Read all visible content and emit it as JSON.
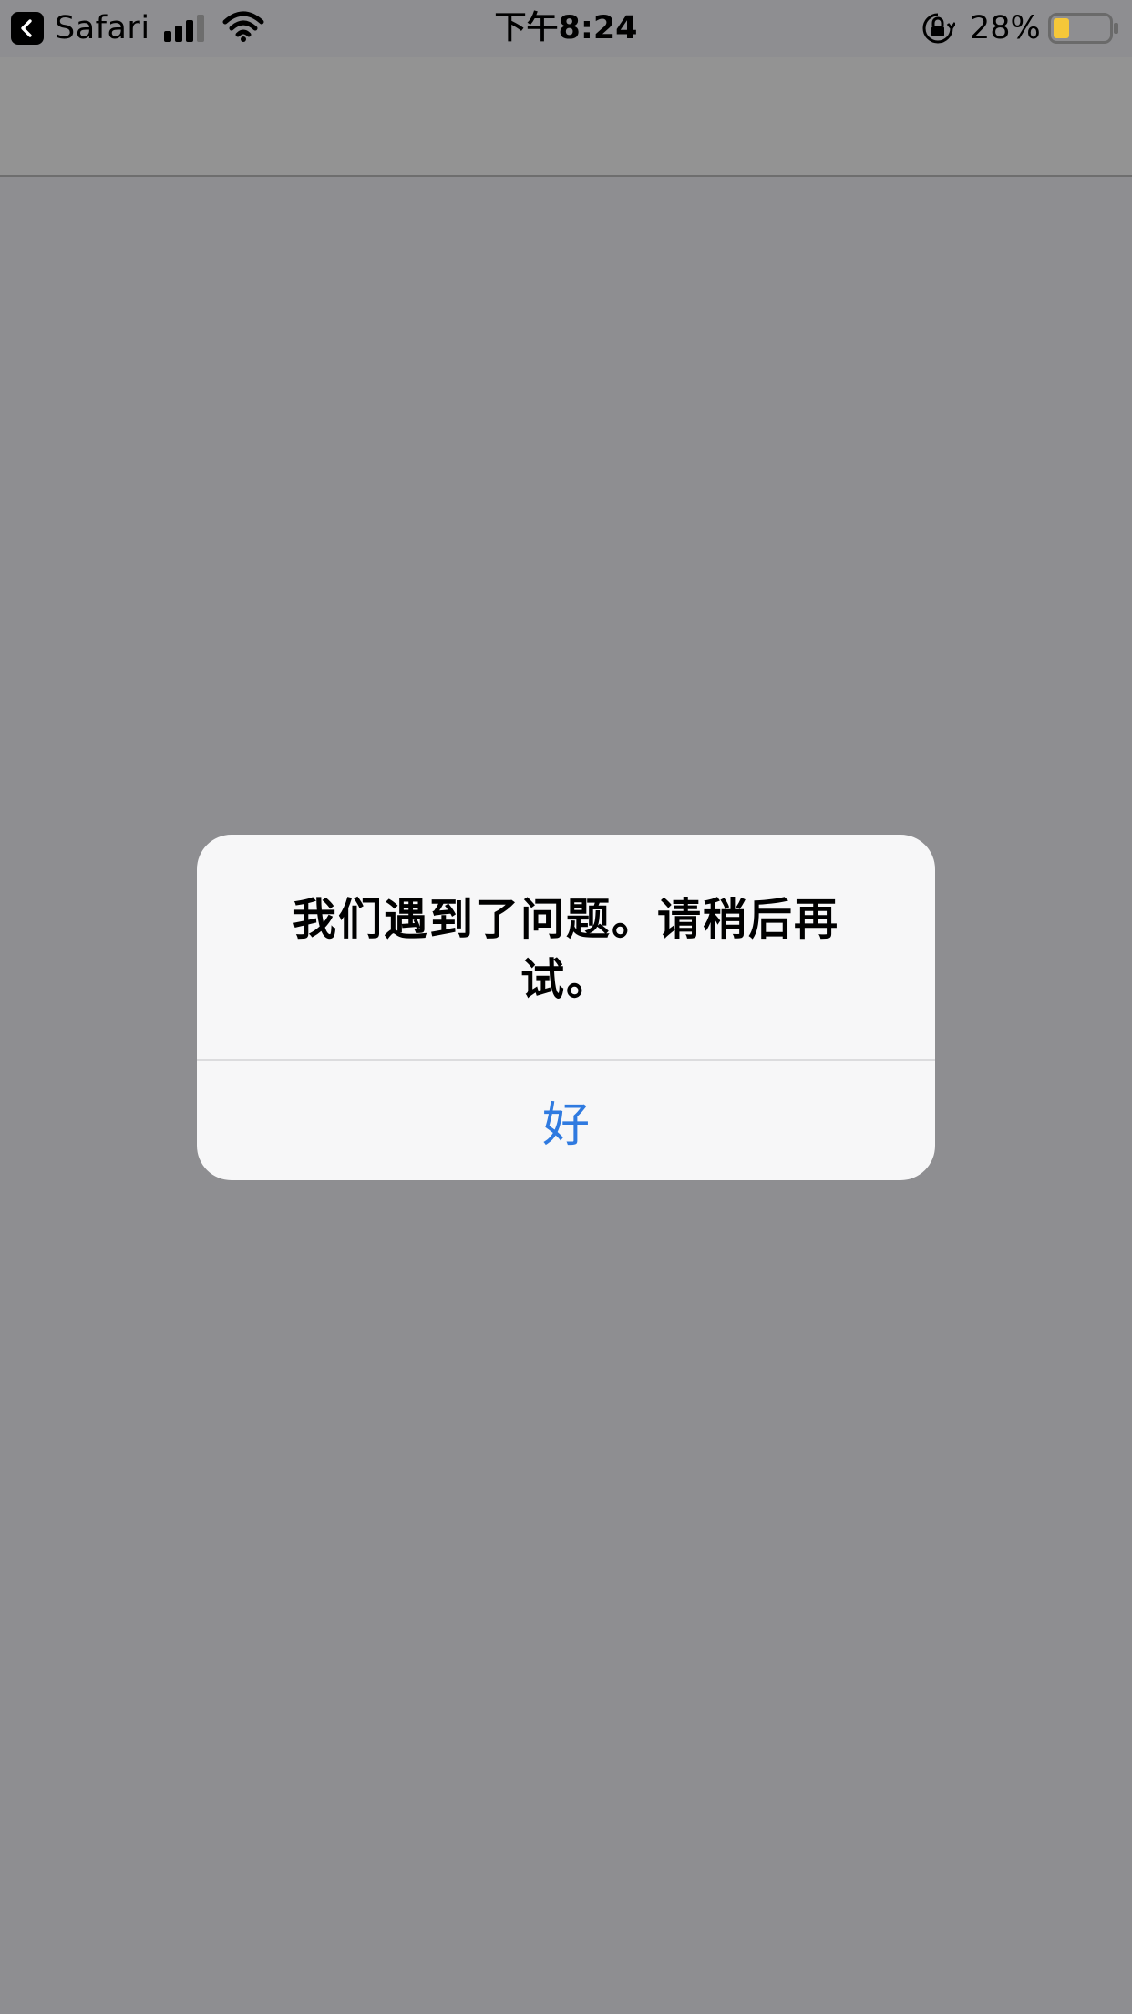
{
  "status_bar": {
    "back_app_label": "Safari",
    "time": "下午8:24",
    "battery_percent": "28%",
    "battery_level": 0.28,
    "icons": [
      "back-arrow-icon",
      "signal-icon",
      "wifi-icon",
      "rotation-lock-icon",
      "battery-icon"
    ]
  },
  "alert": {
    "message": "我们遇到了问题。请稍后再试。",
    "button_label": "好"
  },
  "colors": {
    "overlay_background": "#8e8e91",
    "alert_background": "#f7f7f8",
    "button_text": "#2f7ae0",
    "battery_fill": "#f5c739"
  }
}
